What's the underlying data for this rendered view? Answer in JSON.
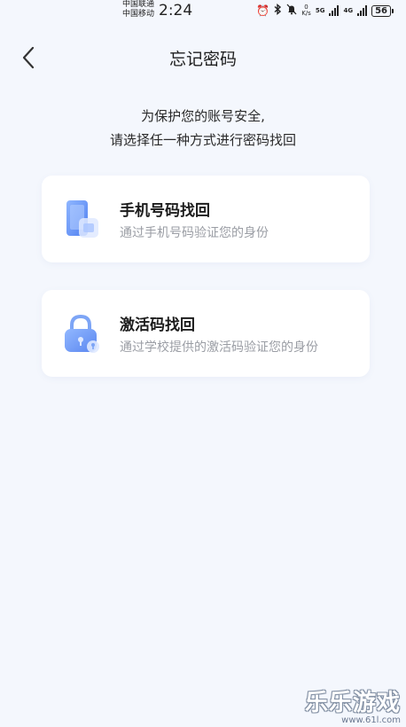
{
  "status_bar": {
    "carrier_1": "中国联通",
    "carrier_2": "中国移动",
    "time": "2:24",
    "speed_value": "0",
    "speed_unit": "K/s",
    "net_1": "5G",
    "net_2": "4G",
    "battery": "56"
  },
  "header": {
    "title": "忘记密码"
  },
  "intro": {
    "line_1": "为保护您的账号安全,",
    "line_2": "请选择任一种方式进行密码找回"
  },
  "options": [
    {
      "title": "手机号码找回",
      "description": "通过手机号码验证您的身份",
      "icon": "phone-icon"
    },
    {
      "title": "激活码找回",
      "description": "通过学校提供的激活码验证您的身份",
      "icon": "lock-icon"
    }
  ],
  "watermark": {
    "main": "乐乐游戏",
    "url": "www.61l.com"
  },
  "colors": {
    "background": "#f4f7fd",
    "card": "#ffffff",
    "icon_blue": "#6f9cf5"
  }
}
